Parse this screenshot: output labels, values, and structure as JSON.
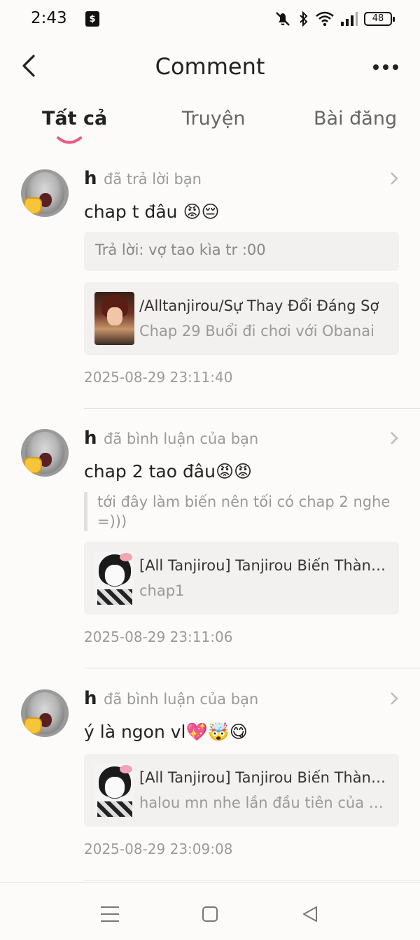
{
  "status_bar": {
    "time": "2:43",
    "battery": "48",
    "icons": [
      "shopping-bag-icon",
      "mute-icon",
      "bluetooth-icon",
      "wifi-icon",
      "signal-icon",
      "battery-icon"
    ]
  },
  "header": {
    "title": "Comment"
  },
  "tabs": [
    {
      "label": "Tất cả",
      "active": true
    },
    {
      "label": "Truyện",
      "active": false
    },
    {
      "label": "Bài đăng",
      "active": false
    }
  ],
  "accent_color": "#f0567c",
  "notifications": [
    {
      "user": "h",
      "action": "đã trả lời bạn",
      "comment": "chap t đâu 😡😔",
      "reply": "Trả lời: vợ tao kìa tr :00",
      "story_title": "/Alltanjirou/Sự Thay Đổi Đáng Sợ",
      "story_subtitle": "Chap 29 Buổi đi chơi với Obanai",
      "time": "2025-08-29 23:11:40"
    },
    {
      "user": "h",
      "action": "đã bình luận của bạn",
      "comment": "chap 2 tao đâu😡😡",
      "quote": "tới đây làm biến nên tối có chap 2 nghe =)))",
      "story_title": "[All Tanjirou] Tanjirou Biến Thành ...",
      "story_subtitle": "chap1",
      "time": "2025-08-29 23:11:06"
    },
    {
      "user": "h",
      "action": "đã bình luận của bạn",
      "comment": "ý là ngon vl💖🤯😋",
      "story_title": "[All Tanjirou] Tanjirou Biến Thành ...",
      "story_subtitle": "halou mn nhe lần đầu tiên của em...",
      "time": "2025-08-29 23:09:08"
    }
  ],
  "nav": {
    "icons": [
      "menu-icon",
      "home-icon",
      "back-icon"
    ]
  }
}
